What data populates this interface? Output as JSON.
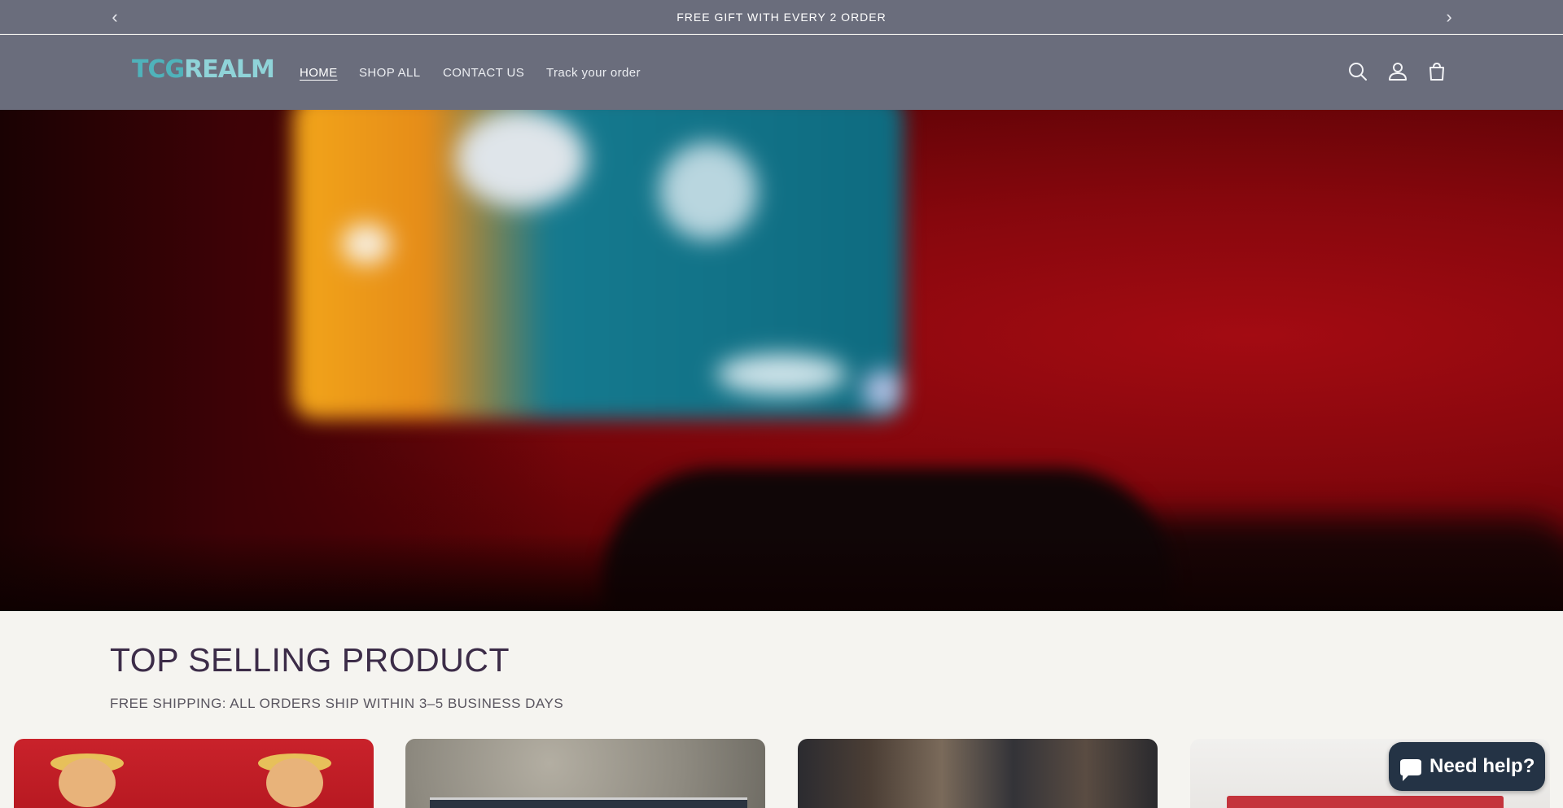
{
  "announcement": {
    "text": "FREE GIFT WITH EVERY 2 ORDER",
    "prev_icon": "chevron-left-icon",
    "next_icon": "chevron-right-icon"
  },
  "header": {
    "logo": {
      "part1": "TCG",
      "part2": "REALM"
    },
    "nav": [
      {
        "label": "HOME",
        "active": true
      },
      {
        "label": "SHOP ALL",
        "active": false
      },
      {
        "label": "CONTACT US",
        "active": false
      },
      {
        "label": "Track your order",
        "active": false
      }
    ],
    "icons": [
      "search-icon",
      "account-icon",
      "cart-icon"
    ]
  },
  "hero": {},
  "section": {
    "title": "TOP SELLING PRODUCT",
    "subtitle": "FREE SHIPPING: ALL ORDERS SHIP WITHIN 3–5 BUSINESS DAYS"
  },
  "chat": {
    "label": "Need help?",
    "icon": "chat-bubble-icon"
  },
  "colors": {
    "header_bg": "#6a6d7c",
    "page_bg": "#f5f4f0",
    "title": "#3c2c48",
    "logo": "#8fd3d8",
    "chat_bg": "#243345"
  }
}
